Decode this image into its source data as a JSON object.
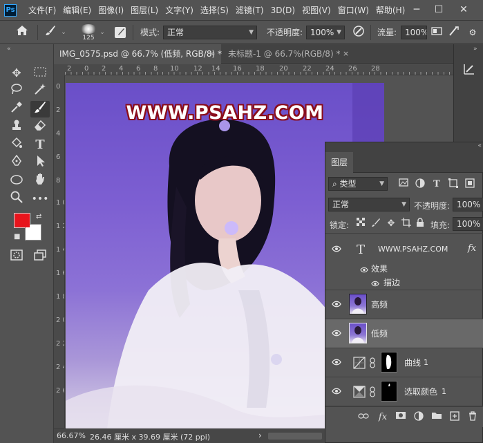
{
  "app": {
    "logo": "Ps"
  },
  "menu": [
    "文件(F)",
    "编辑(E)",
    "图像(I)",
    "图层(L)",
    "文字(Y)",
    "选择(S)",
    "滤镜(T)",
    "3D(D)",
    "视图(V)",
    "窗口(W)",
    "帮助(H)"
  ],
  "window_controls": {
    "minimize": "─",
    "restore": "☐",
    "close": "✕"
  },
  "options": {
    "brush_size": "125",
    "mode_label": "模式:",
    "mode_value": "正常",
    "opacity_label": "不透明度:",
    "opacity_value": "100%",
    "flow_label": "流量:",
    "flow_value": "100%"
  },
  "tabs": [
    {
      "title": "IMG_0575.psd @ 66.7% (低频, RGB/8) *",
      "close": "×"
    },
    {
      "title": "未标题-1 @ 66.7%(RGB/8) *",
      "close": "×"
    }
  ],
  "ruler_top": [
    "2",
    "0",
    "2",
    "4",
    "6",
    "8",
    "10",
    "12",
    "14",
    "16",
    "18",
    "20",
    "22",
    "24",
    "26",
    "28"
  ],
  "ruler_left": [
    "0",
    "2",
    "4",
    "6",
    "8",
    "1 0",
    "1 2",
    "1 4",
    "1 6",
    "1 8",
    "2 0",
    "2 2",
    "2 4",
    "2 6"
  ],
  "canvas": {
    "watermark": "WWW.PSAHZ.COM"
  },
  "colors": {
    "foreground": "#e8141c",
    "background": "#ffffff"
  },
  "status": {
    "zoom": "66.67%",
    "doc_size": "26.46 厘米 x 39.69 厘米 (72 ppi)",
    "arrow": "›"
  },
  "layers_panel": {
    "tab": "图层",
    "filter_label": "类型",
    "blend_mode": "正常",
    "opacity_label": "不透明度:",
    "opacity_value": "100%",
    "lock_label": "锁定:",
    "fill_label": "填充:",
    "fill_value": "100%",
    "layers": [
      {
        "name": "WWW.PSAHZ.COM",
        "type": "text",
        "fx": "fx",
        "effects_label": "效果",
        "effect": "描边"
      },
      {
        "name": "高频",
        "type": "image"
      },
      {
        "name": "低频",
        "type": "image",
        "selected": true
      },
      {
        "name": "曲线",
        "suffix": "1",
        "type": "adjustment"
      },
      {
        "name": "选取颜色",
        "suffix": "1",
        "type": "adjustment"
      }
    ]
  }
}
